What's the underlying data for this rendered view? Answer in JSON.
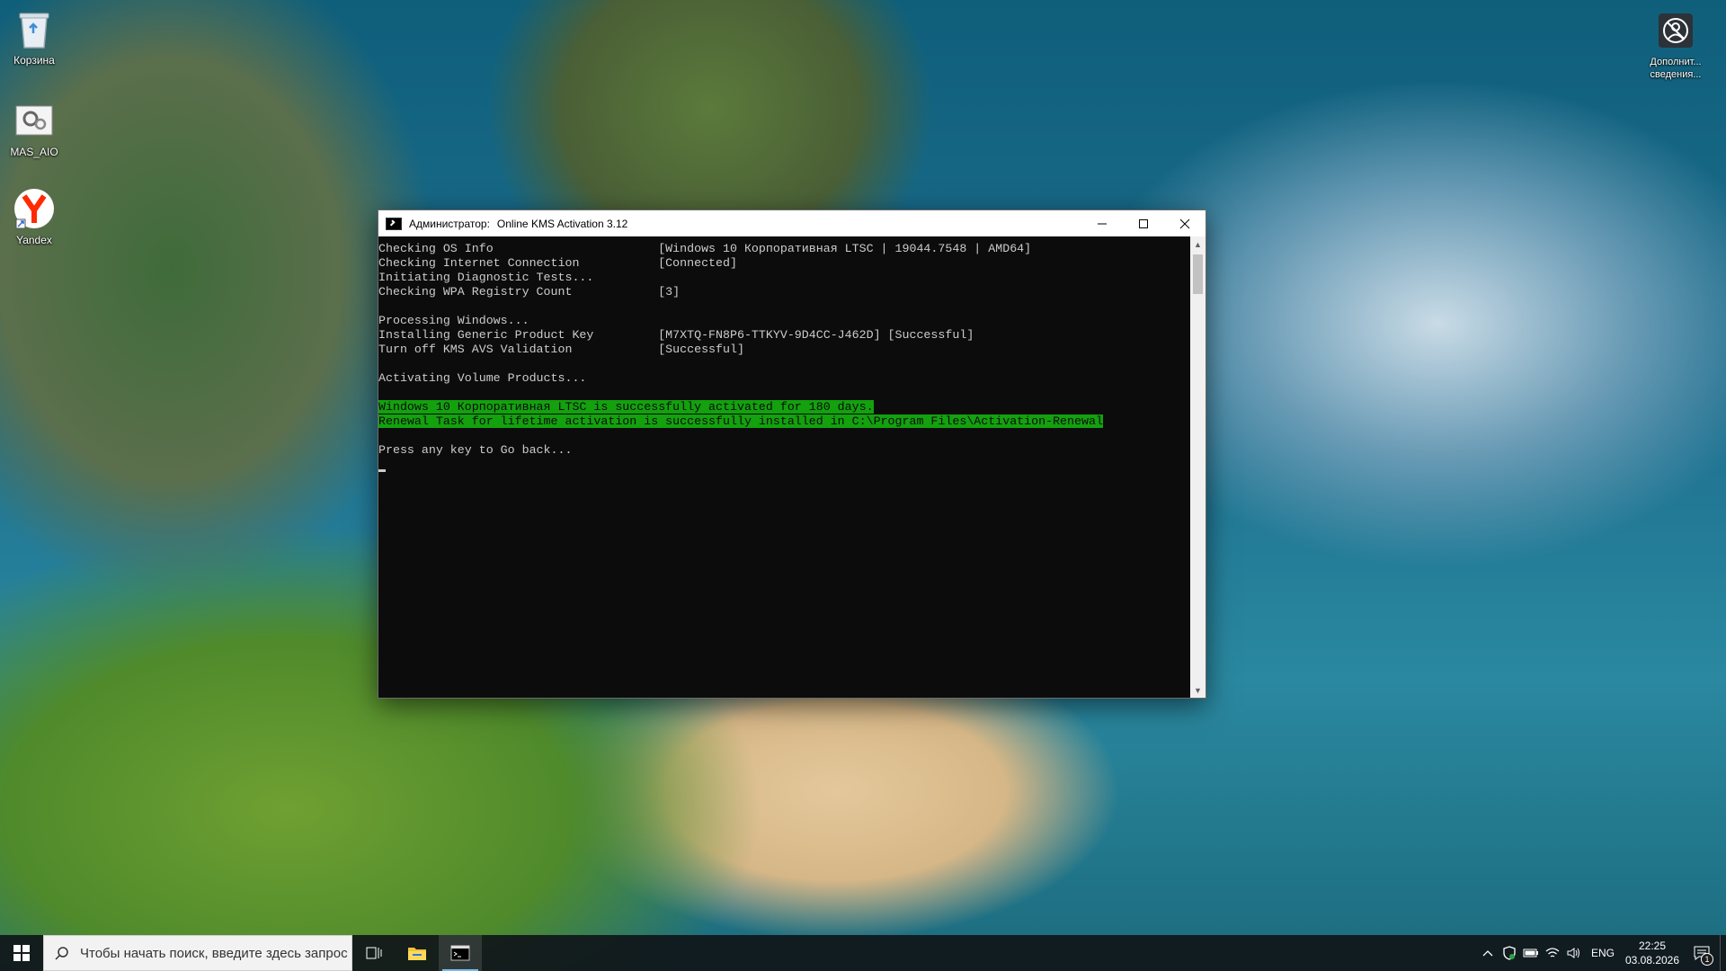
{
  "desktop": {
    "icons": [
      {
        "label": "Корзина"
      },
      {
        "label": "MAS_AIO"
      },
      {
        "label": "Yandex"
      },
      {
        "label": "Дополнит... сведения..."
      }
    ]
  },
  "window": {
    "title_prefix": "Администратор:",
    "title": "Online KMS Activation 3.12"
  },
  "console": {
    "lines": [
      "Checking OS Info                       [Windows 10 Корпоративная LTSC | 19044.7548 | AMD64]",
      "Checking Internet Connection           [Connected]",
      "Initiating Diagnostic Tests...",
      "Checking WPA Registry Count            [3]",
      "",
      "Processing Windows...",
      "Installing Generic Product Key         [M7XTQ-FN8P6-TTKYV-9D4CC-J462D] [Successful]",
      "Turn off KMS AVS Validation            [Successful]",
      "",
      "Activating Volume Products...",
      "",
      "Windows 10 Корпоративная LTSC is successfully activated for 180 days.",
      "Renewal Task for lifetime activation is successfully installed in C:\\Program Files\\Activation-Renewal",
      "",
      "Press any key to Go back..."
    ]
  },
  "taskbar": {
    "search_placeholder": "Чтобы начать поиск, введите здесь запрос",
    "language": "ENG",
    "time": "22:25",
    "date": "03.08.2026",
    "notification_count": "1"
  },
  "colors": {
    "console_bg": "#0c0c0c",
    "console_text": "#cccccc",
    "highlight_bg": "#13a10e"
  }
}
